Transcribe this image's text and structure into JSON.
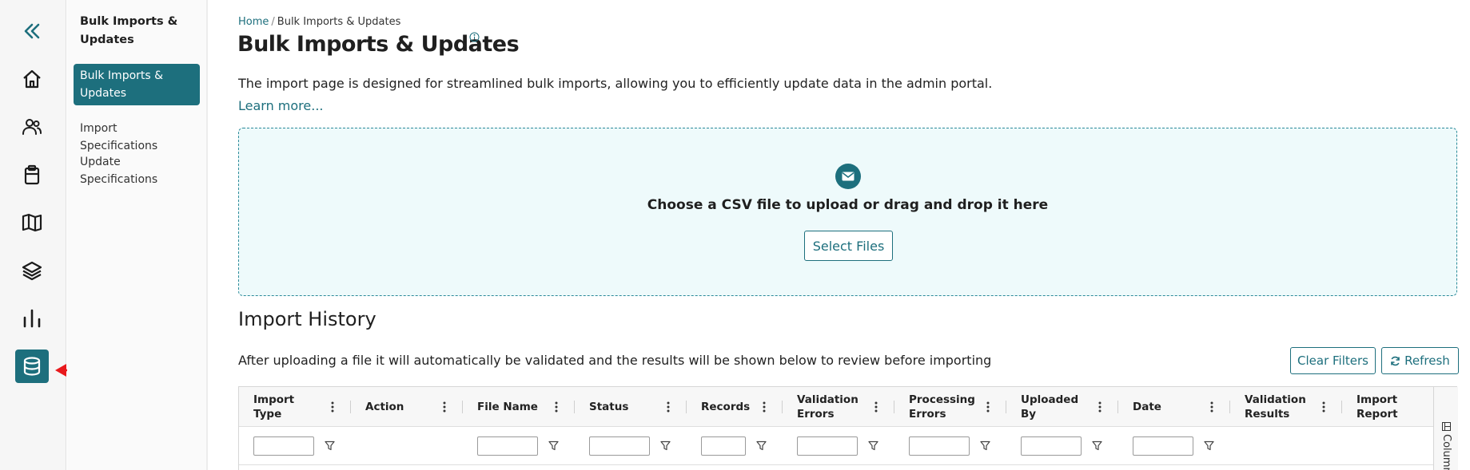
{
  "subnav": {
    "title": "Bulk Imports & Updates",
    "items": [
      {
        "label": "Bulk Imports & Updates"
      },
      {
        "label": "Import Specifications"
      },
      {
        "label": "Update Specifications"
      }
    ]
  },
  "breadcrumb": {
    "home": "Home",
    "separator": "/",
    "current": "Bulk Imports & Updates"
  },
  "page": {
    "title": "Bulk Imports & Updates",
    "description": "The import page is designed for streamlined bulk imports, allowing you to efficiently update data in the admin portal.",
    "learn_more": "Learn more..."
  },
  "dropzone": {
    "text": "Choose a CSV file to upload or drag and drop it here",
    "button": "Select Files"
  },
  "history": {
    "title": "Import History",
    "description": "After uploading a file it will automatically be validated and the results will be shown below to review before importing",
    "clear_filters": "Clear Filters",
    "refresh": "Refresh"
  },
  "table": {
    "columns": [
      "Import Type",
      "Action",
      "File Name",
      "Status",
      "Records",
      "Validation Errors",
      "Processing Errors",
      "Uploaded By",
      "Date",
      "Validation Results",
      "Import Report"
    ],
    "side_panel_label": "Columns"
  },
  "colors": {
    "accent": "#1d6f7d",
    "dropzone_bg": "#eefafb",
    "annotation_arrow": "#e8191c"
  },
  "icons": [
    "collapse-icon",
    "home-icon",
    "users-icon",
    "clipboard-icon",
    "map-icon",
    "layers-icon",
    "bar-chart-icon",
    "database-icon",
    "info-icon",
    "envelope-icon",
    "refresh-icon",
    "filter-icon",
    "kebab-menu-icon",
    "columns-icon"
  ]
}
